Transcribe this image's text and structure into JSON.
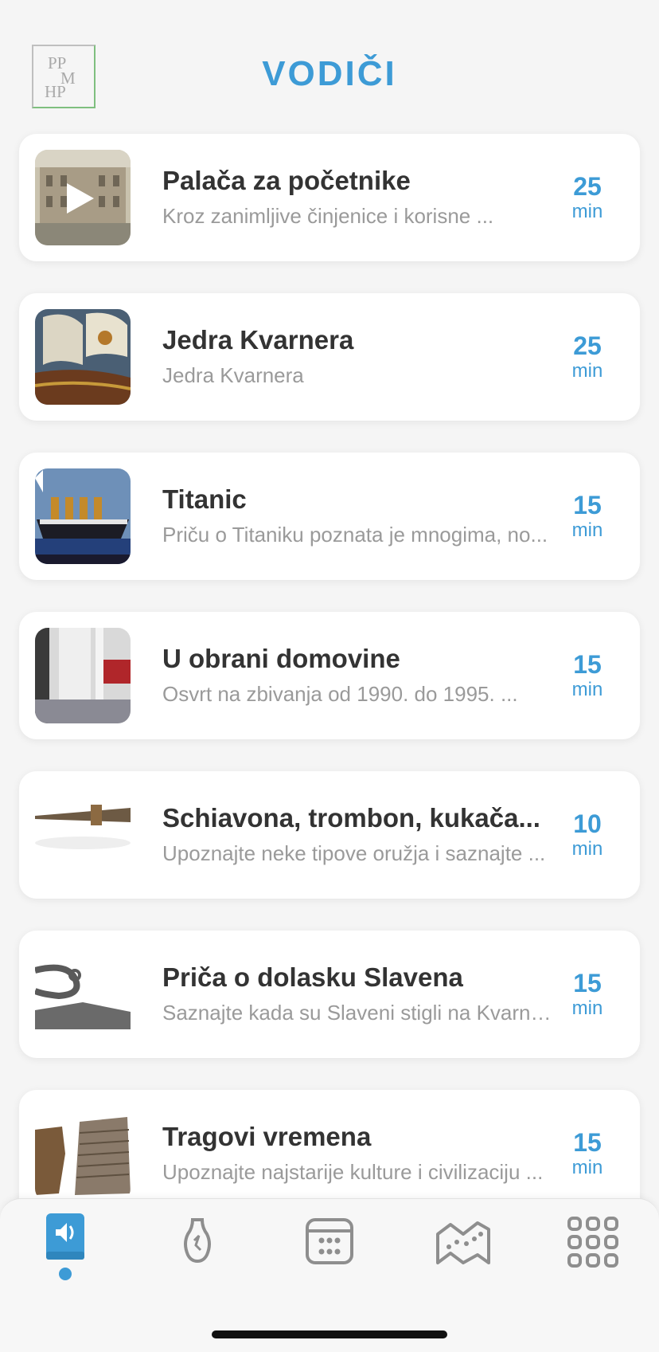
{
  "header": {
    "title": "VODIČI",
    "logo_text": [
      "PP",
      "M",
      "HP"
    ]
  },
  "guides": [
    {
      "title": "Palača za početnike",
      "description": "Kroz zanimljive činjenice i korisne ...",
      "duration": "25",
      "unit": "min",
      "thumb": "palace-photo"
    },
    {
      "title": "Jedra Kvarnera",
      "description": "Jedra Kvarnera",
      "duration": "25",
      "unit": "min",
      "thumb": "sailing-ship-painting"
    },
    {
      "title": "Titanic",
      "description": "Priču o Titaniku poznata je mnogima, no...",
      "duration": "15",
      "unit": "min",
      "thumb": "titanic-poster"
    },
    {
      "title": "U obrani domovine",
      "description": "Osvrt na zbivanja od 1990. do 1995. ...",
      "duration": "15",
      "unit": "min",
      "thumb": "exhibition-room-photo"
    },
    {
      "title": "Schiavona, trombon, kukača...",
      "description": "Upoznajte neke tipove oružja i saznajte ...",
      "duration": "10",
      "unit": "min",
      "thumb": "sword-photo"
    },
    {
      "title": "Priča o dolasku Slavena",
      "description": "Saznajte kada su Slaveni stigli na Kvarne...",
      "duration": "15",
      "unit": "min",
      "thumb": "artifact-photo"
    },
    {
      "title": "Tragovi vremena",
      "description": "Upoznajte najstarije kulture i civilizaciju ...",
      "duration": "15",
      "unit": "min",
      "thumb": "ancient-objects-photo"
    }
  ],
  "tabbar": {
    "items": [
      {
        "icon": "audio-guide-icon",
        "active": true
      },
      {
        "icon": "vase-icon",
        "active": false
      },
      {
        "icon": "calendar-icon",
        "active": false
      },
      {
        "icon": "map-icon",
        "active": false
      },
      {
        "icon": "grid-menu-icon",
        "active": false
      }
    ]
  },
  "colors": {
    "accent": "#3d9bd6",
    "title_text": "#333333",
    "desc_text": "#9a9a9a",
    "icon_gray": "#8e8e8e"
  }
}
